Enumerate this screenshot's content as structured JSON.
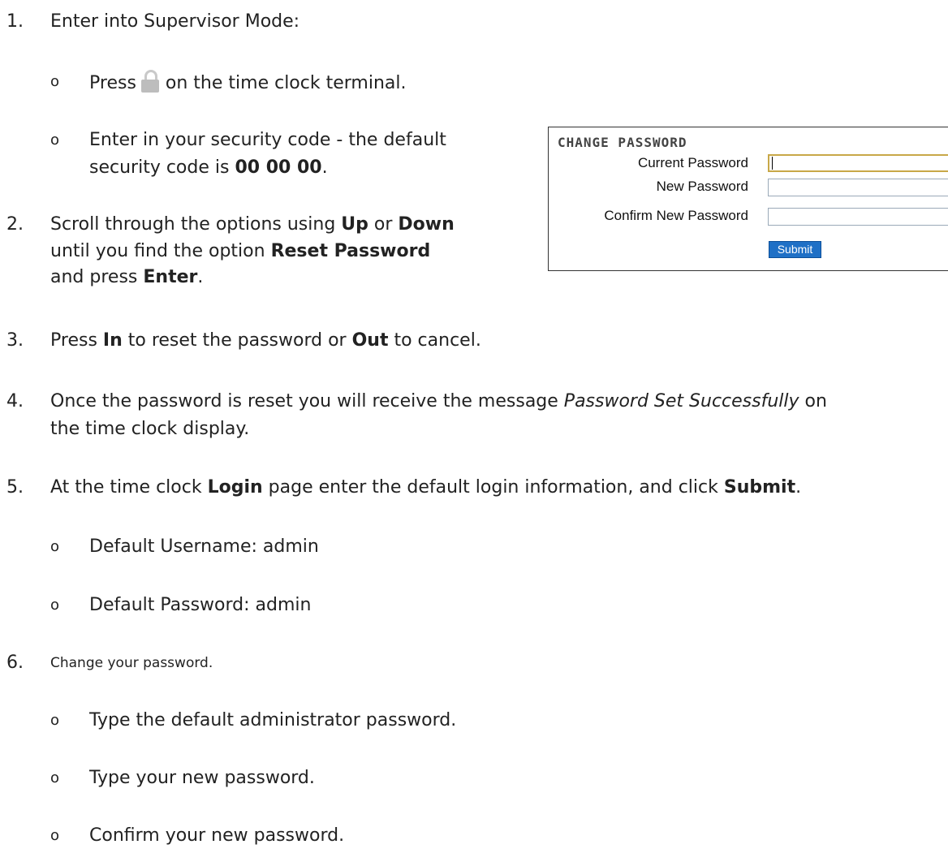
{
  "steps": [
    {
      "number": "1.",
      "text": "Enter into Supervisor Mode:"
    },
    {
      "number": "2.",
      "text_a": "Scroll through the options using ",
      "bold_a": "Up",
      "text_b": " or ",
      "bold_b": "Down",
      "text_c": "until you find the option ",
      "bold_c": "Reset Password",
      "text_d": "and press ",
      "bold_d": "Enter",
      "text_e": "."
    },
    {
      "number": "3.",
      "text_a": "Press ",
      "bold_a": "In",
      "text_b": " to reset the password or ",
      "bold_b": "Out",
      "text_c": " to cancel."
    },
    {
      "number": "4.",
      "text_a": "Once the password is reset you will receive the message ",
      "italic_a": "Password Set Successfully",
      "text_b": " on",
      "text_c": "the time clock display."
    },
    {
      "number": "5.",
      "text_a": "At the time clock ",
      "bold_a": "Login",
      "text_b": " page enter the default login information, and click ",
      "bold_b": "Submit",
      "text_c": "."
    },
    {
      "number": "6.",
      "text": "Change your password."
    }
  ],
  "substeps": {
    "press_a": "Press",
    "press_b": "on the time clock terminal.",
    "security_a": "Enter in your security code - the default",
    "security_b": "security code is ",
    "security_code": "00 00 00",
    "security_end": ".",
    "username": "Default Username: admin",
    "password": "Default Password: admin",
    "type_default": "Type the default administrator password.",
    "type_new": "Type your new password.",
    "confirm_new": "Confirm your new password."
  },
  "bullet": "o",
  "icons": {
    "lock": "lock-icon"
  },
  "change_password_panel": {
    "title": "CHANGE PASSWORD",
    "current_label": "Current Password",
    "new_label": "New Password",
    "confirm_label": "Confirm New Password",
    "current_value": "",
    "new_value": "",
    "confirm_value": "",
    "submit_label": "Submit"
  },
  "colors": {
    "submit_bg": "#1f70c6",
    "focus_border": "#c8a848",
    "input_border": "#9aa9b8"
  }
}
